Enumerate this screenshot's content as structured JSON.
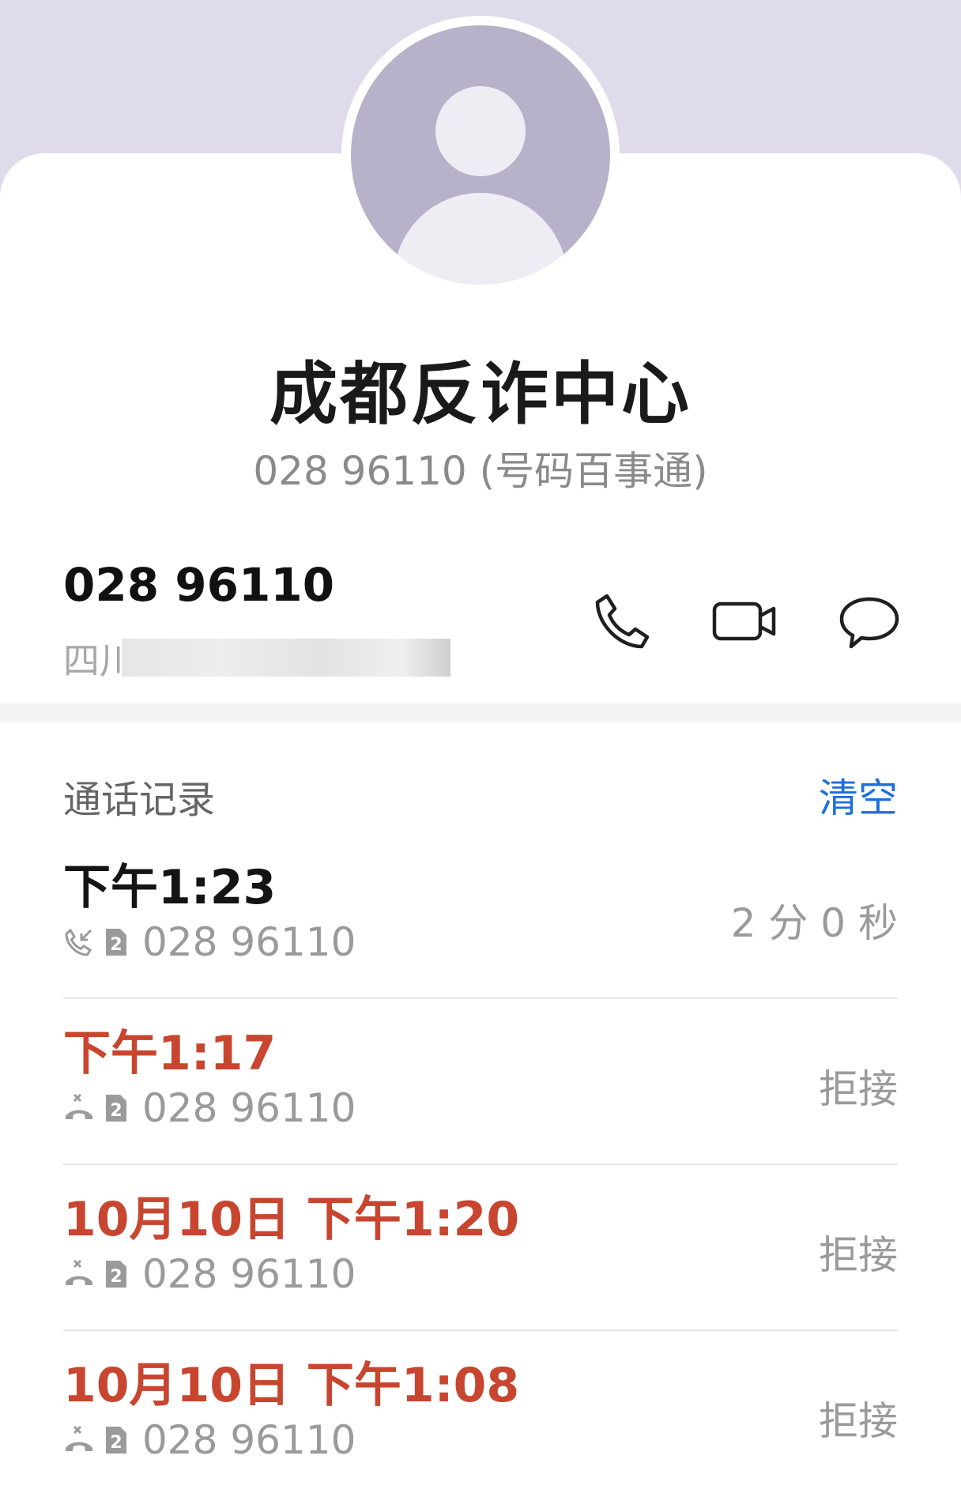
{
  "contact": {
    "name": "成都反诈中心",
    "subtitle": "028 96110 (号码百事通)"
  },
  "number": {
    "value": "028 96110",
    "location": "四川"
  },
  "actions": {
    "call_icon": "phone-icon",
    "video_icon": "video-camera-icon",
    "message_icon": "message-bubble-icon"
  },
  "history": {
    "title": "通话记录",
    "clear_label": "清空",
    "rows": [
      {
        "time": "下午1:23",
        "number": "028 96110",
        "status": "2 分 0 秒",
        "type": "incoming",
        "sim": "2"
      },
      {
        "time": "下午1:17",
        "number": "028 96110",
        "status": "拒接",
        "type": "rejected",
        "sim": "2"
      },
      {
        "time": "10月10日 下午1:20",
        "number": "028 96110",
        "status": "拒接",
        "type": "rejected",
        "sim": "2"
      },
      {
        "time": "10月10日 下午1:08",
        "number": "028 96110",
        "status": "拒接",
        "type": "rejected",
        "sim": "2"
      }
    ]
  },
  "colors": {
    "header_band": "#e0dbea",
    "avatar": "#b7b1c9",
    "missed": "#c8452f",
    "accent": "#1e6fd9"
  }
}
